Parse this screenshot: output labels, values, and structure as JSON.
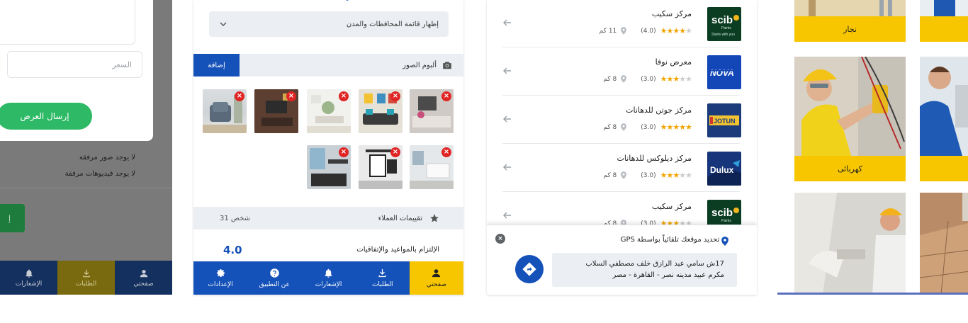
{
  "panel1": {
    "price_placeholder": "السعر",
    "send_button": "إرسال العرض",
    "no_images": "لا يوجد صور مرفقة",
    "no_videos": "لا يوجد فيديوهات مرفقة",
    "partial_button": "إ",
    "nav": [
      {
        "label": "صفحتي",
        "icon": "user-icon"
      },
      {
        "label": "الطلبات",
        "icon": "download-icon"
      },
      {
        "label": "الإشعارات",
        "icon": "bell-icon"
      }
    ]
  },
  "panel2": {
    "province_select": "إظهار قائمة المحافظات والمدن",
    "album_label": "ألبوم الصور",
    "add_button": "إضافة",
    "delete_glyph": "×",
    "reviews_label": "تقييمات العملاء",
    "reviews_count": "31 شخص",
    "commitment_label": "الإلتزام بالمواعيد والإتفاقيات",
    "commitment_score": "4.0",
    "nav": [
      {
        "label": "صفحتي",
        "icon": "user-icon"
      },
      {
        "label": "الطلبات",
        "icon": "download-icon"
      },
      {
        "label": "الإشعارات",
        "icon": "bell-icon"
      },
      {
        "label": "عن التطبيق",
        "icon": "help-icon"
      },
      {
        "label": "الإعدادات",
        "icon": "gear-icon"
      }
    ]
  },
  "panel3": {
    "vendors": [
      {
        "name": "مركز سكيب",
        "rating": 4,
        "rating_text": "(4.0)",
        "distance": "11 كم",
        "logo": "scib"
      },
      {
        "name": "معرض نوفا",
        "rating": 3,
        "rating_text": "(3.0)",
        "distance": "8 كم",
        "logo": "nova"
      },
      {
        "name": "مركز جوتن للدهانات",
        "rating": 5,
        "rating_text": "(3.0)",
        "distance": "8 كم",
        "logo": "jotun"
      },
      {
        "name": "مركز ديلوكس للدهانات",
        "rating": 3,
        "rating_text": "(3.0)",
        "distance": "8 كم",
        "logo": "dulux"
      },
      {
        "name": "مركز سكيب",
        "rating": 3,
        "rating_text": "(3.0)",
        "distance": "8 كم",
        "logo": "scib"
      }
    ],
    "logo_text": {
      "scib": "scib",
      "scib_sub": "Paints",
      "scib_tag": "Starts with you",
      "nova": "NOVA",
      "jotun": "JOTUN",
      "dulux": "Dulux"
    },
    "gps": {
      "title": "تم تحديد موقعك تلقائياً بواسطة GPS",
      "address_line1": "17ش سامي عبد الرازق خلف مصطفي السلاب",
      "address_line2": "مكرم عبيد مدينه نصر - القاهرة - مصر",
      "close_glyph": "×"
    }
  },
  "panel4": {
    "captions": [
      "نجار",
      "كهربائى"
    ]
  },
  "colors": {
    "primary": "#1451b8",
    "accent": "#f7c600",
    "green": "#2db965",
    "nav_dark": "#14305f"
  }
}
